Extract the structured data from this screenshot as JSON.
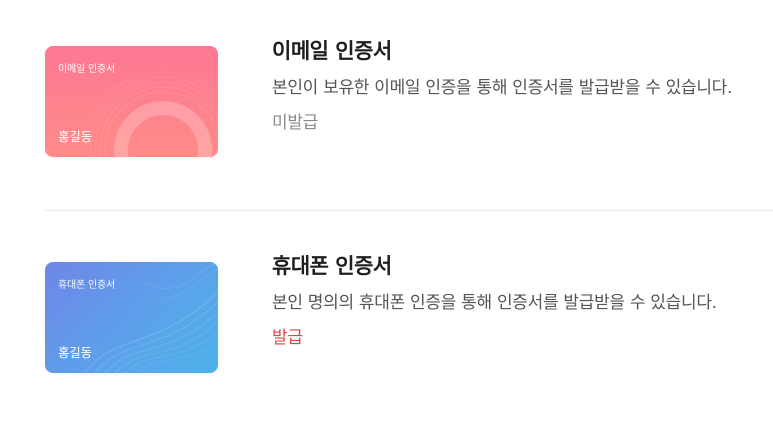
{
  "certificates": [
    {
      "card_title": "이메일 인증서",
      "card_holder": "홍길동",
      "title": "이메일 인증서",
      "description": "본인이 보유한 이메일 인증을 통해 인증서를 발급받을 수 있습니다.",
      "status": "미발급",
      "status_color": "#8a8a8a",
      "card_colors": [
        "#fd7894",
        "#ff8b88"
      ]
    },
    {
      "card_title": "휴대폰 인증서",
      "card_holder": "홍길동",
      "title": "휴대폰 인증서",
      "description": "본인 명의의 휴대폰 인증을 통해 인증서를 발급받을 수 있습니다.",
      "status": "발급",
      "status_color": "#e0444a",
      "card_colors": [
        "#6f86e8",
        "#4db2ea"
      ]
    }
  ]
}
